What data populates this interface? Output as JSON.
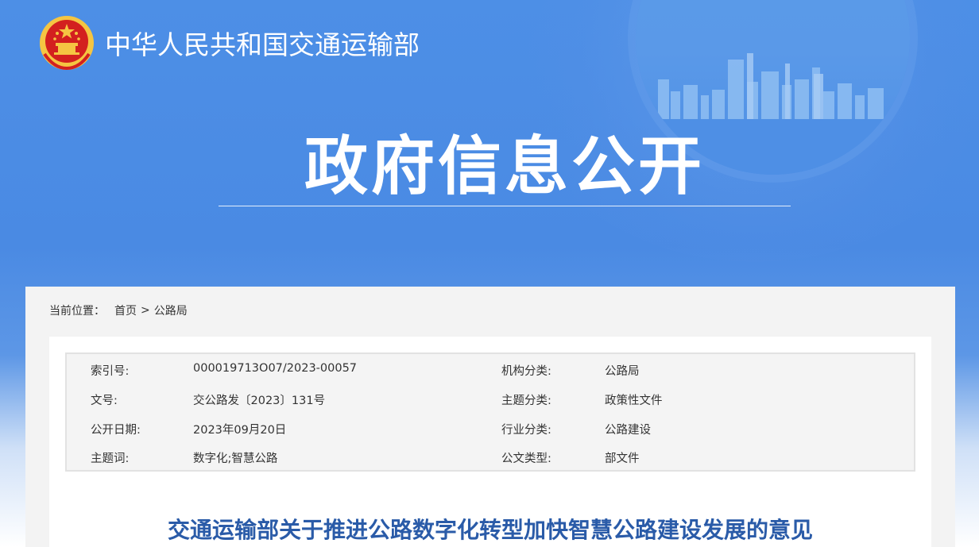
{
  "site": {
    "name": "中华人民共和国交通运输部"
  },
  "hero": {
    "title": "政府信息公开"
  },
  "breadcrumb": {
    "prefix": "当前位置：",
    "items": [
      "首页",
      "公路局"
    ],
    "separator": ">"
  },
  "meta": {
    "rows": [
      {
        "label1": "索引号:",
        "value1": "000019713O07/2023-00057",
        "label2": "机构分类:",
        "value2": "公路局"
      },
      {
        "label1": "文号:",
        "value1": "交公路发〔2023〕131号",
        "label2": "主题分类:",
        "value2": "政策性文件"
      },
      {
        "label1": "公开日期:",
        "value1": "2023年09月20日",
        "label2": "行业分类:",
        "value2": "公路建设"
      },
      {
        "label1": "主题词:",
        "value1": "数字化;智慧公路",
        "label2": "公文类型:",
        "value2": "部文件"
      }
    ]
  },
  "document": {
    "title": "交通运输部关于推进公路数字化转型加快智慧公路建设发展的意见"
  },
  "colors": {
    "hero_blue": "#4a8ae3",
    "title_blue": "#2a5ba8",
    "emblem_red": "#d3201f",
    "emblem_gold": "#f5c542"
  }
}
